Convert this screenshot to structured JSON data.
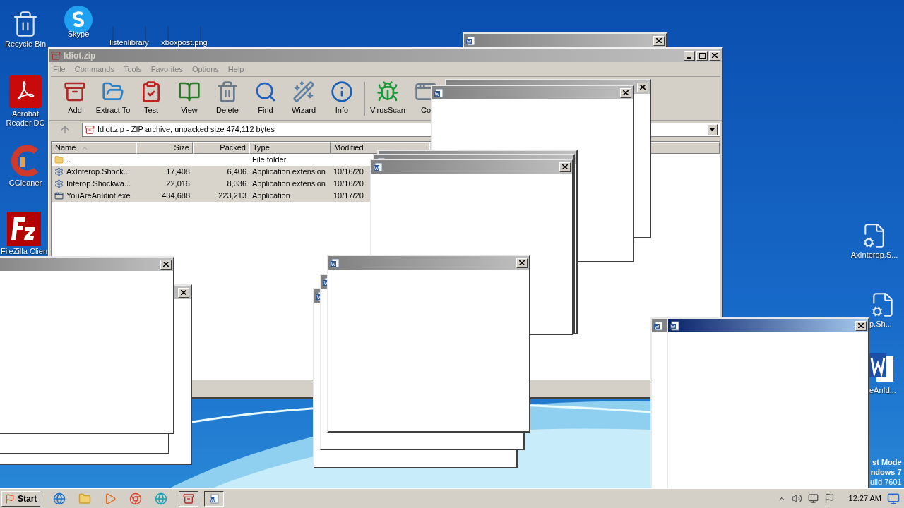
{
  "desktop_icons": [
    {
      "label": "Recycle Bin",
      "kind": "bin"
    },
    {
      "label": "Skype",
      "kind": "skype"
    },
    {
      "label": "listenlibrary",
      "kind": "blank"
    },
    {
      "label": "xboxpost.png",
      "kind": "blank"
    },
    {
      "label": "Acrobat Reader DC",
      "kind": "acrobat"
    },
    {
      "label": "CCleaner",
      "kind": "ccleaner"
    },
    {
      "label": "FileZilla Clien",
      "kind": "filezilla"
    },
    {
      "label": "AxInterop.S...",
      "kind": "dll"
    },
    {
      "label": "p.Sh...",
      "kind": "dll"
    },
    {
      "label": "eAnId...",
      "kind": "word"
    }
  ],
  "archiver": {
    "title": "Idiot.zip",
    "menu": [
      "File",
      "Commands",
      "Tools",
      "Favorites",
      "Options",
      "Help"
    ],
    "toolbar": [
      {
        "label": "Add",
        "kind": "add"
      },
      {
        "label": "Extract To",
        "kind": "extract"
      },
      {
        "label": "Test",
        "kind": "test"
      },
      {
        "label": "View",
        "kind": "view"
      },
      {
        "label": "Delete",
        "kind": "delete"
      },
      {
        "label": "Find",
        "kind": "find"
      },
      {
        "label": "Wizard",
        "kind": "wizard"
      },
      {
        "label": "Info",
        "kind": "info"
      },
      {
        "label": "VirusScan",
        "kind": "virus"
      },
      {
        "label": "Co",
        "kind": "comment"
      }
    ],
    "address": "Idiot.zip - ZIP archive, unpacked size 474,112 bytes",
    "columns": [
      "Name",
      "Size",
      "Packed",
      "Type",
      "Modified"
    ],
    "rows": [
      {
        "name": "..",
        "size": "",
        "packed": "",
        "type": "File folder",
        "modified": "",
        "kind": "folder",
        "selected": false
      },
      {
        "name": "AxInterop.Shock...",
        "size": "17,408",
        "packed": "6,406",
        "type": "Application extension",
        "modified": "10/16/20",
        "kind": "dll",
        "selected": true
      },
      {
        "name": "Interop.Shockwa...",
        "size": "22,016",
        "packed": "8,336",
        "type": "Application extension",
        "modified": "10/16/20",
        "kind": "dll",
        "selected": true
      },
      {
        "name": "YouAreAnIdiot.exe",
        "size": "434,688",
        "packed": "223,213",
        "type": "Application",
        "modified": "10/17/20",
        "kind": "exe",
        "selected": true
      }
    ]
  },
  "popups": [
    {
      "kind": "window",
      "active": false
    },
    {
      "kind": "window",
      "active": false
    },
    {
      "kind": "window",
      "active": false
    },
    {
      "kind": "window",
      "active": false
    },
    {
      "kind": "window",
      "active": false
    },
    {
      "kind": "window",
      "active": false
    },
    {
      "kind": "window",
      "active": false
    },
    {
      "kind": "frame"
    },
    {
      "kind": "window",
      "active": false
    },
    {
      "kind": "window",
      "active": false
    },
    {
      "kind": "window",
      "active": false
    },
    {
      "kind": "window",
      "active": false
    },
    {
      "kind": "window",
      "active": false
    },
    {
      "kind": "window",
      "active": true
    }
  ],
  "desktop_notice": [
    "st Mode",
    "ndows 7",
    "uild 7601"
  ],
  "taskbar": {
    "start": "Start",
    "clock": "12:27 AM"
  }
}
